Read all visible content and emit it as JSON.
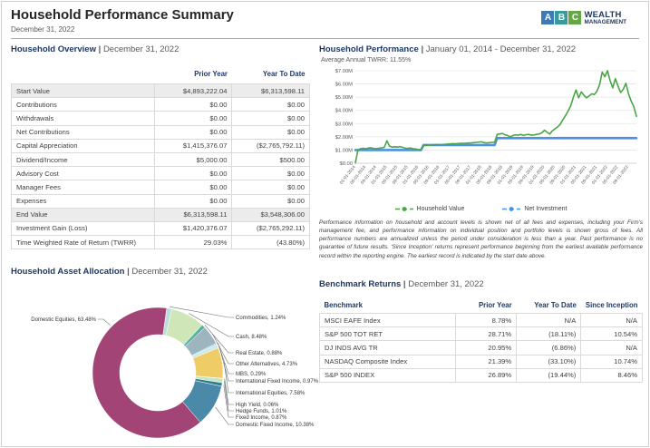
{
  "header": {
    "title": "Household Performance Summary",
    "date": "December 31, 2022",
    "logo": {
      "letters": [
        "A",
        "B",
        "C"
      ],
      "line1": "WEALTH",
      "line2": "MANAGEMENT"
    }
  },
  "overview": {
    "title": "Household Overview",
    "date": "December 31, 2022",
    "columns": [
      "Prior Year",
      "Year To Date"
    ],
    "rows": [
      {
        "label": "Start Value",
        "prior": "$4,893,222.04",
        "ytd": "$6,313,598.11",
        "shaded": true
      },
      {
        "label": "Contributions",
        "prior": "$0.00",
        "ytd": "$0.00",
        "shaded": false
      },
      {
        "label": "Withdrawals",
        "prior": "$0.00",
        "ytd": "$0.00",
        "shaded": false
      },
      {
        "label": "Net Contributions",
        "prior": "$0.00",
        "ytd": "$0.00",
        "shaded": false
      },
      {
        "label": "Capital Appreciation",
        "prior": "$1,415,376.07",
        "ytd": "($2,765,792.11)",
        "shaded": false
      },
      {
        "label": "Dividend/Income",
        "prior": "$5,000.00",
        "ytd": "$500.00",
        "shaded": false
      },
      {
        "label": "Advisory Cost",
        "prior": "$0.00",
        "ytd": "$0.00",
        "shaded": false
      },
      {
        "label": "Manager Fees",
        "prior": "$0.00",
        "ytd": "$0.00",
        "shaded": false
      },
      {
        "label": "Expenses",
        "prior": "$0.00",
        "ytd": "$0.00",
        "shaded": false
      },
      {
        "label": "End Value",
        "prior": "$6,313,598.11",
        "ytd": "$3,548,306.00",
        "shaded": true
      },
      {
        "label": "Investment Gain (Loss)",
        "prior": "$1,420,376.07",
        "ytd": "($2,765,292.11)",
        "shaded": false
      },
      {
        "label": "Time Weighted Rate of Return (TWRR)",
        "prior": "29.03%",
        "ytd": "(43.80%)",
        "shaded": false
      }
    ]
  },
  "performance": {
    "title": "Household Performance",
    "date_range": "January 01, 2014 - December 31, 2022",
    "avg_twrr": "Average Annual TWRR: 11.55%",
    "disclaimer": "Performance information on household and account levels is shown net of all fees and expenses, including your Firm's management fee, and performance information on individual position and portfolio levels is shown gross of fees. All performance numbers are annualized unless the period under consideration is less than a year. Past performance is no guarantee of future results. 'Since Inception' returns represent performance beginning from the earliest available performance record within the reporting engine. The earliest record is indicated by the start date above."
  },
  "allocation": {
    "title": "Household Asset Allocation",
    "date": "December 31, 2022"
  },
  "benchmarks": {
    "title": "Benchmark Returns",
    "date": "December 31, 2022",
    "columns": [
      "Benchmark",
      "Prior Year",
      "Year To Date",
      "Since Inception"
    ],
    "rows": [
      [
        "MSCI EAFE Index",
        "8.78%",
        "N/A",
        "N/A"
      ],
      [
        "S&P 500 TOT RET",
        "28.71%",
        "(18.11%)",
        "10.54%"
      ],
      [
        "DJ INDS AVG TR",
        "20.95%",
        "(6.86%)",
        "N/A"
      ],
      [
        "NASDAQ Composite Index",
        "21.39%",
        "(33.10%)",
        "10.74%"
      ],
      [
        "S&P 500 INDEX",
        "26.89%",
        "(19.44%)",
        "8.46%"
      ]
    ]
  },
  "chart_data": [
    {
      "type": "line",
      "title": "Household Performance",
      "xlabel": "",
      "ylabel": "",
      "ylim": [
        0,
        7000000
      ],
      "y_ticks": [
        "$0.00",
        "$1.00M",
        "$2.00M",
        "$3.00M",
        "$4.00M",
        "$5.00M",
        "$6.00M",
        "$7.00M"
      ],
      "x_ticks": [
        "01-01-2014",
        "05-01-2014",
        "09-01-2014",
        "01-01-2015",
        "05-01-2015",
        "09-01-2015",
        "01-01-2016",
        "05-01-2016",
        "09-01-2016",
        "01-01-2017",
        "05-01-2017",
        "09-01-2017",
        "01-01-2018",
        "05-01-2018",
        "09-01-2018",
        "01-01-2019",
        "05-01-2019",
        "09-01-2019",
        "01-01-2020",
        "05-01-2020",
        "09-01-2020",
        "01-01-2021",
        "05-01-2021",
        "09-01-2021",
        "01-01-2022",
        "05-01-2022",
        "09-01-2022"
      ],
      "grid": true,
      "legend_position": "bottom",
      "unit": "millions USD",
      "series": [
        {
          "name": "Net Investment",
          "color": "#4c92e0",
          "points": [
            [
              "2014-01",
              1.0
            ],
            [
              "2016-02",
              1.0
            ],
            [
              "2016-03",
              1.38
            ],
            [
              "2018-06",
              1.38
            ],
            [
              "2018-07",
              1.9
            ],
            [
              "2022-12",
              1.9
            ]
          ]
        },
        {
          "name": "Household Value",
          "color": "#4aa546",
          "points": [
            [
              "2014-01",
              0.02
            ],
            [
              "2014-02",
              1.02
            ],
            [
              "2014-03",
              1.1
            ],
            [
              "2014-04",
              1.13
            ],
            [
              "2014-05",
              1.1
            ],
            [
              "2014-06",
              1.15
            ],
            [
              "2014-07",
              1.16
            ],
            [
              "2014-08",
              1.12
            ],
            [
              "2014-09",
              1.1
            ],
            [
              "2014-10",
              1.14
            ],
            [
              "2014-11",
              1.16
            ],
            [
              "2014-12",
              1.2
            ],
            [
              "2015-01",
              1.7
            ],
            [
              "2015-02",
              1.3
            ],
            [
              "2015-03",
              1.22
            ],
            [
              "2015-04",
              1.25
            ],
            [
              "2015-05",
              1.22
            ],
            [
              "2015-06",
              1.26
            ],
            [
              "2015-07",
              1.2
            ],
            [
              "2015-08",
              1.14
            ],
            [
              "2015-09",
              1.12
            ],
            [
              "2015-10",
              1.16
            ],
            [
              "2015-11",
              1.1
            ],
            [
              "2015-12",
              1.08
            ],
            [
              "2016-01",
              1.02
            ],
            [
              "2016-02",
              1.0
            ],
            [
              "2016-03",
              1.36
            ],
            [
              "2016-04",
              1.38
            ],
            [
              "2016-05",
              1.36
            ],
            [
              "2016-06",
              1.38
            ],
            [
              "2016-07",
              1.4
            ],
            [
              "2016-08",
              1.42
            ],
            [
              "2016-09",
              1.4
            ],
            [
              "2016-10",
              1.41
            ],
            [
              "2016-11",
              1.43
            ],
            [
              "2016-12",
              1.45
            ],
            [
              "2017-01",
              1.46
            ],
            [
              "2017-02",
              1.48
            ],
            [
              "2017-03",
              1.47
            ],
            [
              "2017-04",
              1.49
            ],
            [
              "2017-05",
              1.5
            ],
            [
              "2017-06",
              1.51
            ],
            [
              "2017-07",
              1.52
            ],
            [
              "2017-08",
              1.53
            ],
            [
              "2017-09",
              1.54
            ],
            [
              "2017-10",
              1.56
            ],
            [
              "2017-11",
              1.58
            ],
            [
              "2017-12",
              1.6
            ],
            [
              "2018-01",
              1.62
            ],
            [
              "2018-02",
              1.56
            ],
            [
              "2018-03",
              1.54
            ],
            [
              "2018-04",
              1.56
            ],
            [
              "2018-05",
              1.58
            ],
            [
              "2018-06",
              1.6
            ],
            [
              "2018-07",
              2.18
            ],
            [
              "2018-08",
              2.22
            ],
            [
              "2018-09",
              2.25
            ],
            [
              "2018-10",
              2.15
            ],
            [
              "2018-11",
              2.1
            ],
            [
              "2018-12",
              2.0
            ],
            [
              "2019-01",
              2.1
            ],
            [
              "2019-02",
              2.15
            ],
            [
              "2019-03",
              2.12
            ],
            [
              "2019-04",
              2.18
            ],
            [
              "2019-05",
              2.1
            ],
            [
              "2019-06",
              2.16
            ],
            [
              "2019-07",
              2.18
            ],
            [
              "2019-08",
              2.12
            ],
            [
              "2019-09",
              2.14
            ],
            [
              "2019-10",
              2.18
            ],
            [
              "2019-11",
              2.22
            ],
            [
              "2019-12",
              2.3
            ],
            [
              "2020-01",
              2.5
            ],
            [
              "2020-02",
              2.35
            ],
            [
              "2020-03",
              2.2
            ],
            [
              "2020-04",
              2.45
            ],
            [
              "2020-05",
              2.6
            ],
            [
              "2020-06",
              2.75
            ],
            [
              "2020-07",
              2.95
            ],
            [
              "2020-08",
              3.3
            ],
            [
              "2020-09",
              3.6
            ],
            [
              "2020-10",
              3.95
            ],
            [
              "2020-11",
              4.35
            ],
            [
              "2020-12",
              5.0
            ],
            [
              "2021-01",
              5.55
            ],
            [
              "2021-02",
              4.95
            ],
            [
              "2021-03",
              5.4
            ],
            [
              "2021-04",
              5.15
            ],
            [
              "2021-05",
              4.95
            ],
            [
              "2021-06",
              5.1
            ],
            [
              "2021-07",
              5.25
            ],
            [
              "2021-08",
              5.2
            ],
            [
              "2021-09",
              5.45
            ],
            [
              "2021-10",
              5.95
            ],
            [
              "2021-11",
              6.9
            ],
            [
              "2021-12",
              6.55
            ],
            [
              "2022-01",
              7.0
            ],
            [
              "2022-02",
              6.25
            ],
            [
              "2022-03",
              5.7
            ],
            [
              "2022-04",
              6.4
            ],
            [
              "2022-05",
              5.85
            ],
            [
              "2022-06",
              5.35
            ],
            [
              "2022-07",
              5.6
            ],
            [
              "2022-08",
              6.05
            ],
            [
              "2022-09",
              5.25
            ],
            [
              "2022-10",
              4.7
            ],
            [
              "2022-11",
              4.3
            ],
            [
              "2022-12",
              3.55
            ]
          ]
        }
      ]
    },
    {
      "type": "donut",
      "title": "Household Asset Allocation",
      "slices": [
        {
          "label": "Commodities",
          "value": 1.24,
          "color": "#b9dedb"
        },
        {
          "label": "Cash",
          "value": 8.48,
          "color": "#cfe7b8"
        },
        {
          "label": "Real Estate",
          "value": 0.88,
          "color": "#52b0a8"
        },
        {
          "label": "Other Alternatives",
          "value": 4.73,
          "color": "#9db5bf"
        },
        {
          "label": "MBS",
          "value": 0.29,
          "color": "#7ecddd"
        },
        {
          "label": "International Fixed Income",
          "value": 0.97,
          "color": "#cfe9e9"
        },
        {
          "label": "International Equities",
          "value": 7.58,
          "color": "#f0cc66"
        },
        {
          "label": "High Yield",
          "value": 0.06,
          "color": "#e09c3f"
        },
        {
          "label": "Hedge Funds",
          "value": 1.01,
          "color": "#c6e6c3"
        },
        {
          "label": "Fixed Income",
          "value": 0.87,
          "color": "#2f7f93"
        },
        {
          "label": "Domestic Fixed Income",
          "value": 10.38,
          "color": "#4a8aa8"
        },
        {
          "label": "Domestic Equities",
          "value": 63.48,
          "color": "#a34477"
        }
      ]
    }
  ]
}
